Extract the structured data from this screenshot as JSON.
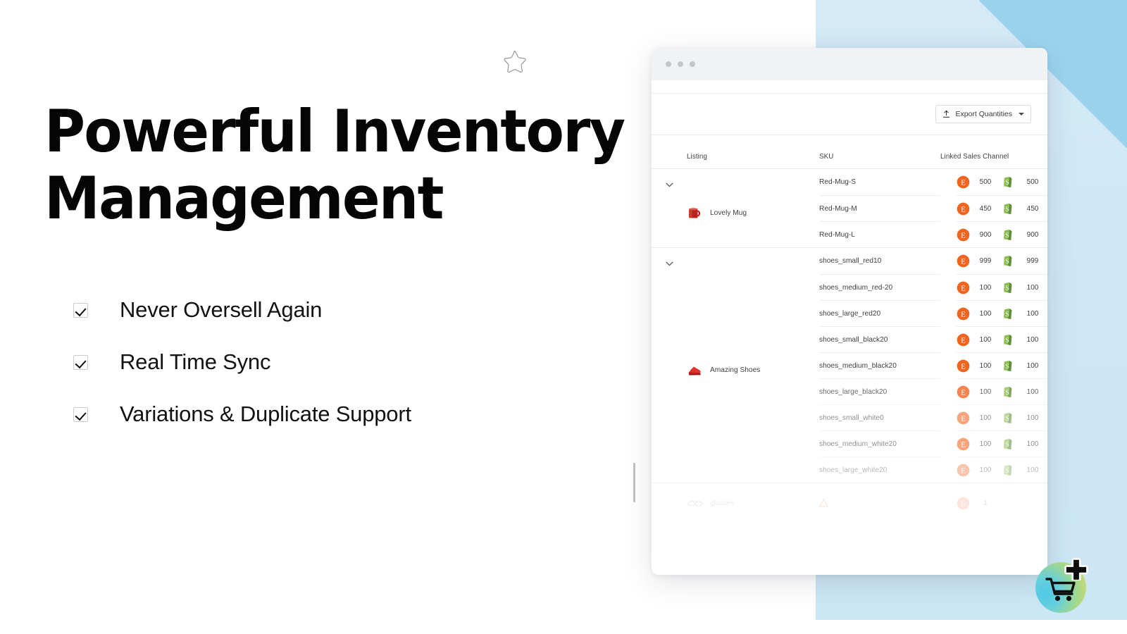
{
  "hero": {
    "title_line1": "Powerful Inventory",
    "title_line2": "Management",
    "features": [
      {
        "label": "Never Oversell Again",
        "icon": "checkbox-checked-icon"
      },
      {
        "label": "Real Time Sync",
        "icon": "checkbox-checked-icon"
      },
      {
        "label": "Variations & Duplicate Support",
        "icon": "checkbox-checked-icon"
      }
    ],
    "decorations": {
      "star": "star-outline-icon",
      "scroll_rule": "vertical-scroll-indicator"
    }
  },
  "colors": {
    "panel_blue": "#cfe7f5",
    "panel_corner_blue": "#9bd3ee",
    "etsy_orange": "#F1641E",
    "shopify_green": "#7AB55C",
    "heading_black": "#050505",
    "cart_gradient_from": "#4fc9e8",
    "cart_gradient_to": "#ecd95f"
  },
  "app": {
    "window_controls": [
      "close-dot",
      "minimize-dot",
      "maximize-dot"
    ],
    "toolbar": {
      "export_label": "Export Quantities",
      "export_icon": "upload-icon",
      "caret_icon": "chevron-down-icon"
    },
    "table": {
      "headers": {
        "listing": "Listing",
        "sku": "SKU",
        "channel": "Linked Sales Channel"
      },
      "groups": [
        {
          "name": "Lovely Mug",
          "thumb": "red-mug-thumbnail",
          "toggle_icon": "chevron-down-icon",
          "rows": [
            {
              "sku": "Red-Mug-S",
              "etsy_qty": "500",
              "shopify_qty": "500",
              "fade": ""
            },
            {
              "sku": "Red-Mug-M",
              "etsy_qty": "450",
              "shopify_qty": "450",
              "fade": ""
            },
            {
              "sku": "Red-Mug-L",
              "etsy_qty": "900",
              "shopify_qty": "900",
              "fade": ""
            }
          ]
        },
        {
          "name": "Amazing Shoes",
          "thumb": "red-shoes-thumbnail",
          "toggle_icon": "chevron-down-icon",
          "rows": [
            {
              "sku": "shoes_small_red10",
              "etsy_qty": "999",
              "shopify_qty": "999",
              "fade": ""
            },
            {
              "sku": "shoes_medium_red-20",
              "etsy_qty": "100",
              "shopify_qty": "100",
              "fade": ""
            },
            {
              "sku": "shoes_large_red20",
              "etsy_qty": "100",
              "shopify_qty": "100",
              "fade": ""
            },
            {
              "sku": "shoes_small_black20",
              "etsy_qty": "100",
              "shopify_qty": "100",
              "fade": ""
            },
            {
              "sku": "shoes_medium_black20",
              "etsy_qty": "100",
              "shopify_qty": "100",
              "fade": ""
            },
            {
              "sku": "shoes_large_black20",
              "etsy_qty": "100",
              "shopify_qty": "100",
              "fade": "f1"
            },
            {
              "sku": "shoes_small_white0",
              "etsy_qty": "100",
              "shopify_qty": "100",
              "fade": "f2"
            },
            {
              "sku": "shoes_medium_white20",
              "etsy_qty": "100",
              "shopify_qty": "100",
              "fade": "f2"
            },
            {
              "sku": "shoes_large_white20",
              "etsy_qty": "100",
              "shopify_qty": "100",
              "fade": "f3"
            }
          ]
        }
      ],
      "partial_group": {
        "name": "glasses",
        "thumb": "glasses-thumbnail",
        "warning_icon": "warning-triangle-icon"
      }
    },
    "channel_badges": {
      "etsy": {
        "label": "E",
        "name": "etsy-logo-icon"
      },
      "shopify": {
        "label": "S",
        "name": "shopify-logo-icon"
      }
    }
  },
  "fab": {
    "icon": "shopping-cart-icon",
    "plus_icon": "plus-icon"
  }
}
